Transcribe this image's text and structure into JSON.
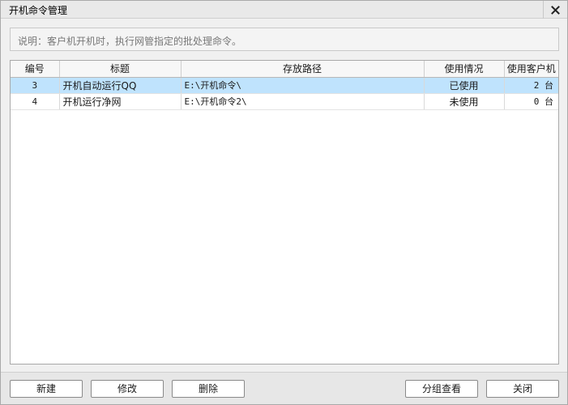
{
  "window": {
    "title": "开机命令管理"
  },
  "description": {
    "text": "说明：客户机开机时，执行网管指定的批处理命令。"
  },
  "table": {
    "columns": [
      "编号",
      "标题",
      "存放路径",
      "使用情况",
      "使用客户机"
    ],
    "rows": [
      {
        "id": "3",
        "title": "开机自动运行QQ",
        "path": "E:\\开机命令\\",
        "status": "已使用",
        "clients": "2 台",
        "selected": true
      },
      {
        "id": "4",
        "title": "开机运行净网",
        "path": "E:\\开机命令2\\",
        "status": "未使用",
        "clients": "0 台",
        "selected": false
      }
    ]
  },
  "buttons": {
    "new": "新建",
    "edit": "修改",
    "delete": "删除",
    "group_view": "分组查看",
    "close": "关闭"
  },
  "colors": {
    "selected_row": "#bfe3fd",
    "window_bg": "#f0f0f0"
  },
  "icons": {
    "close": "close-icon"
  }
}
